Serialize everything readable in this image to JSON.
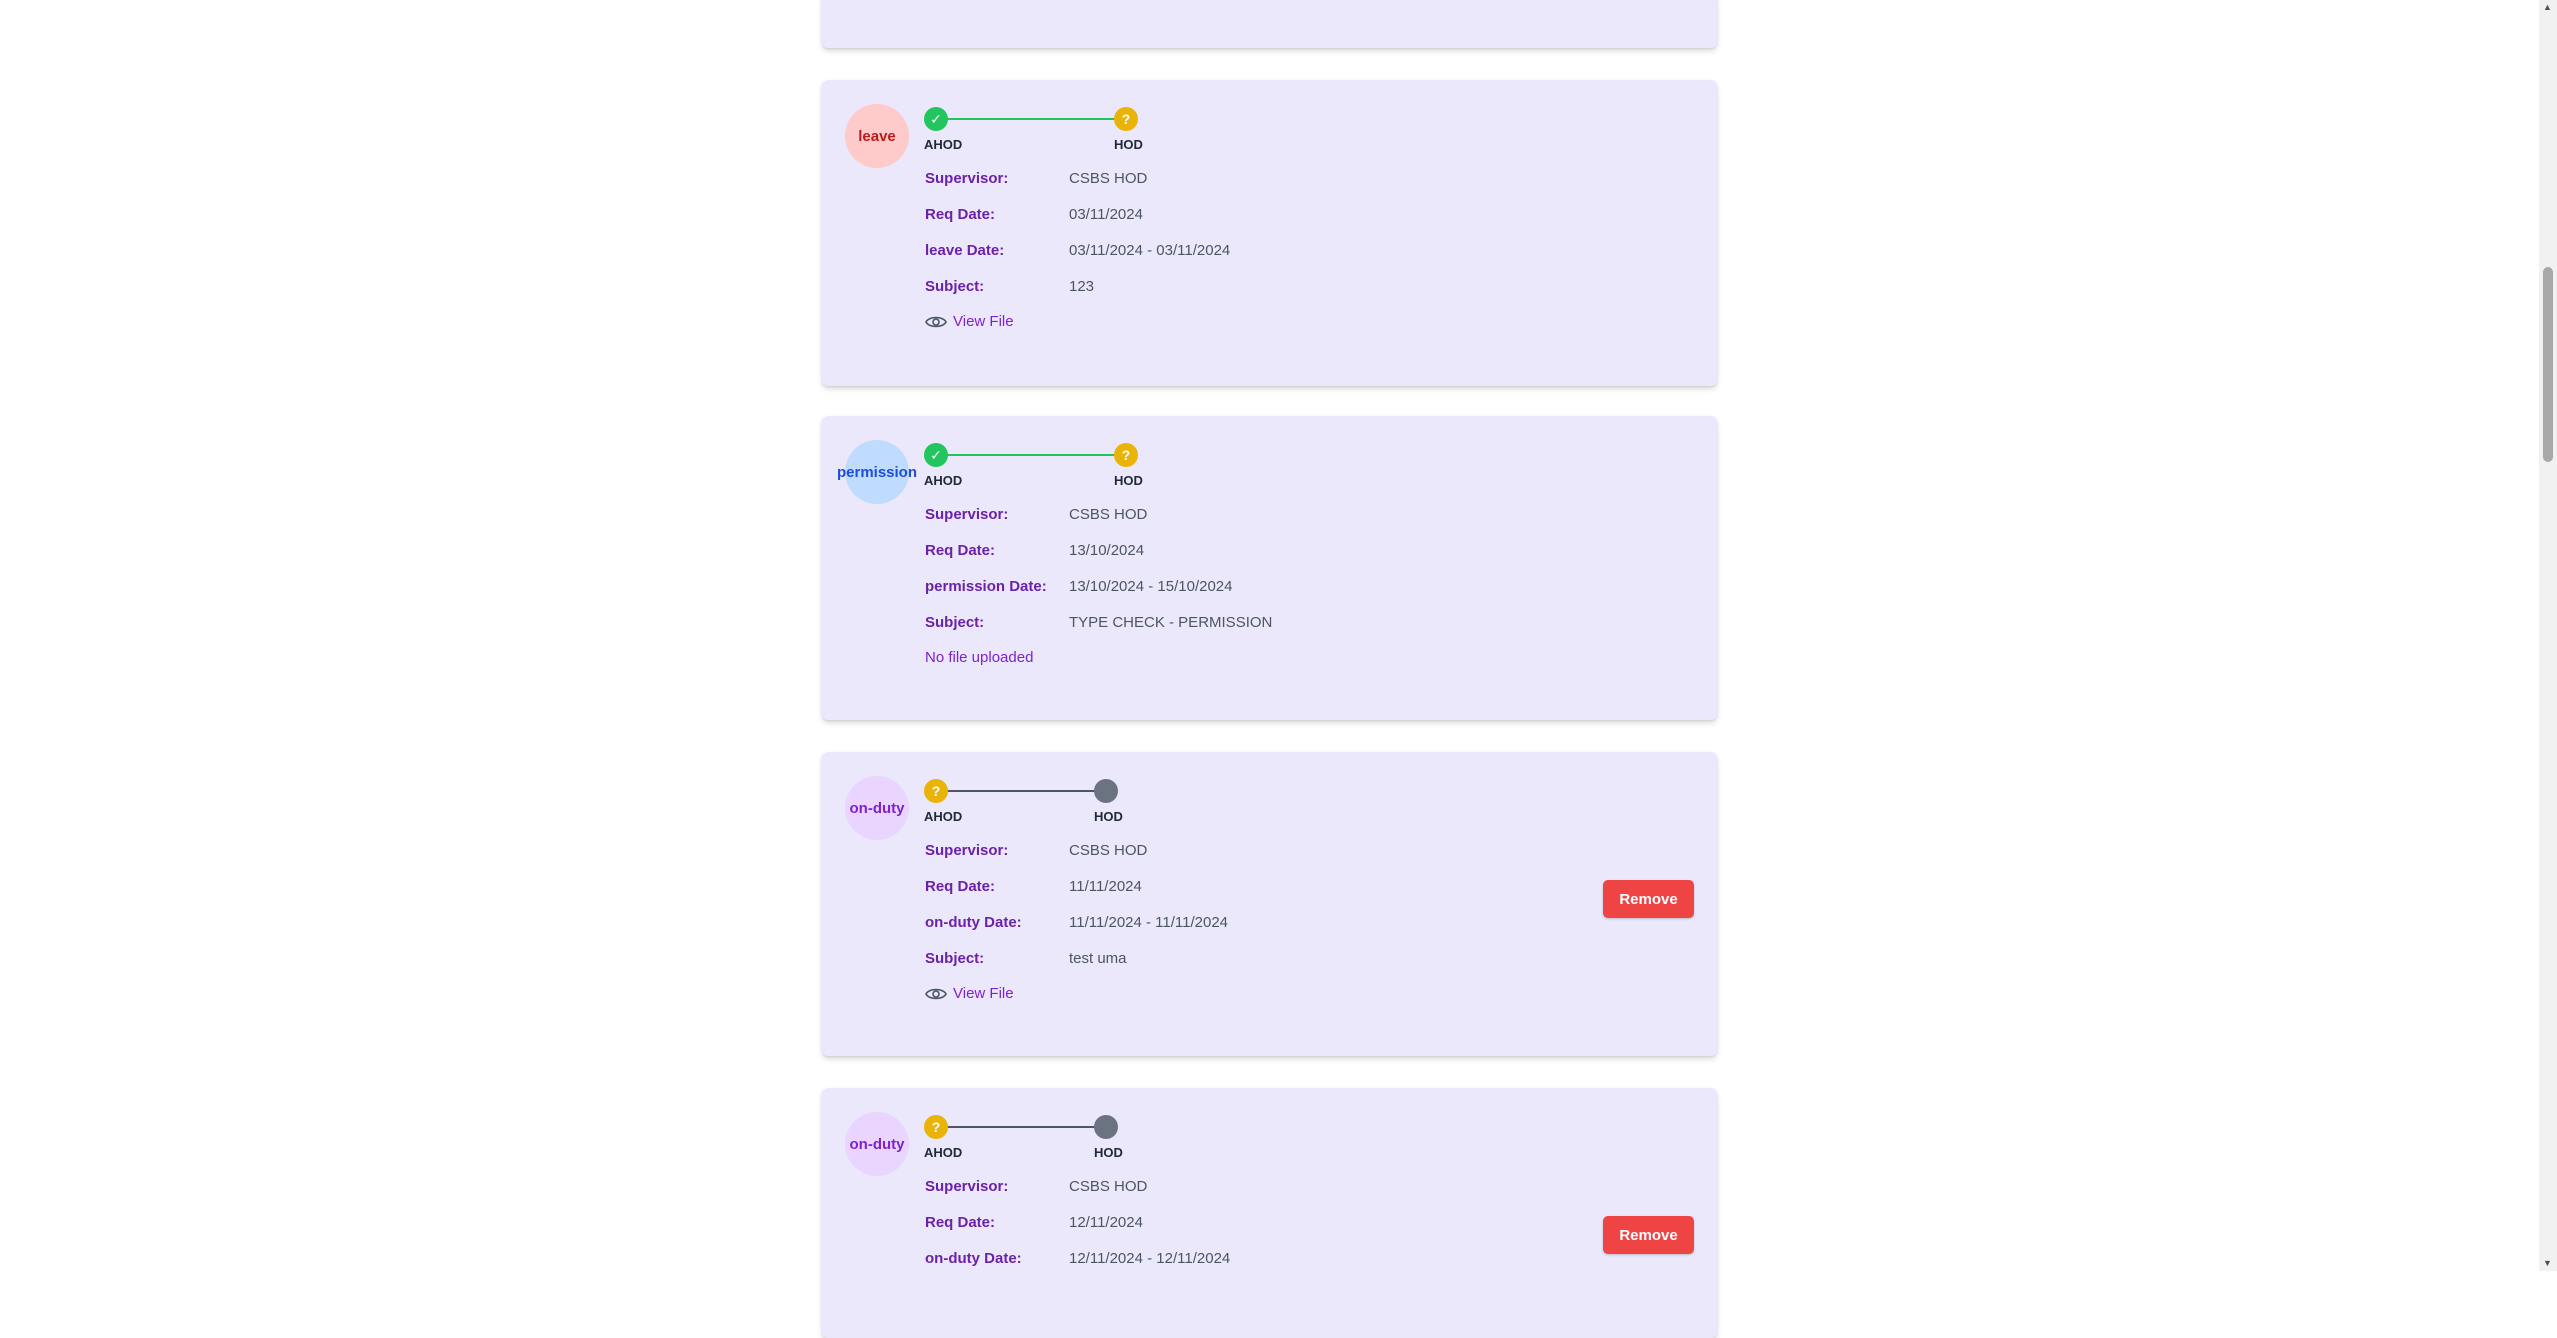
{
  "requests": [
    {
      "type": "leave",
      "steps": [
        {
          "label": "AHOD",
          "status": "approved",
          "glyph": "✓"
        },
        {
          "label": "HOD",
          "status": "pending",
          "glyph": "?"
        }
      ],
      "fields": [
        {
          "key": "Supervisor:",
          "value": "CSBS HOD"
        },
        {
          "key": "Req Date:",
          "value": "03/11/2024"
        },
        {
          "key": "leave Date:",
          "value": "03/11/2024 - 03/11/2024"
        },
        {
          "key": "Subject:",
          "value": "123"
        }
      ],
      "file_label": "View File"
    },
    {
      "type": "permission",
      "steps": [
        {
          "label": "AHOD",
          "status": "approved",
          "glyph": "✓"
        },
        {
          "label": "HOD",
          "status": "pending",
          "glyph": "?"
        }
      ],
      "fields": [
        {
          "key": "Supervisor:",
          "value": "CSBS HOD"
        },
        {
          "key": "Req Date:",
          "value": "13/10/2024"
        },
        {
          "key": "permission Date:",
          "value": "13/10/2024 - 15/10/2024"
        },
        {
          "key": "Subject:",
          "value": "TYPE CHECK - PERMISSION"
        }
      ],
      "file_label": "No file uploaded"
    },
    {
      "type": "on-duty",
      "steps": [
        {
          "label": "AHOD",
          "status": "pending",
          "glyph": "?"
        },
        {
          "label": "HOD",
          "status": "not-started",
          "glyph": ""
        }
      ],
      "fields": [
        {
          "key": "Supervisor:",
          "value": "CSBS HOD"
        },
        {
          "key": "Req Date:",
          "value": "11/11/2024"
        },
        {
          "key": "on-duty Date:",
          "value": "11/11/2024 - 11/11/2024"
        },
        {
          "key": "Subject:",
          "value": "test uma"
        }
      ],
      "file_label": "View File",
      "remove_label": "Remove"
    },
    {
      "type": "on-duty",
      "steps": [
        {
          "label": "AHOD",
          "status": "pending",
          "glyph": "?"
        },
        {
          "label": "HOD",
          "status": "not-started",
          "glyph": ""
        }
      ],
      "fields": [
        {
          "key": "Supervisor:",
          "value": "CSBS HOD"
        },
        {
          "key": "Req Date:",
          "value": "12/11/2024"
        },
        {
          "key": "on-duty Date:",
          "value": "12/11/2024 - 12/11/2024"
        }
      ],
      "remove_label": "Remove"
    }
  ],
  "colors": {
    "card_bg": "#ebe8fc",
    "label": "#6b21a8",
    "approved": "#22c55e",
    "pending": "#eab308",
    "not_started": "#6b7280",
    "remove": "#ef4444"
  },
  "icons": {
    "approved": "check-icon",
    "pending": "question-icon",
    "file": "eye-icon"
  }
}
